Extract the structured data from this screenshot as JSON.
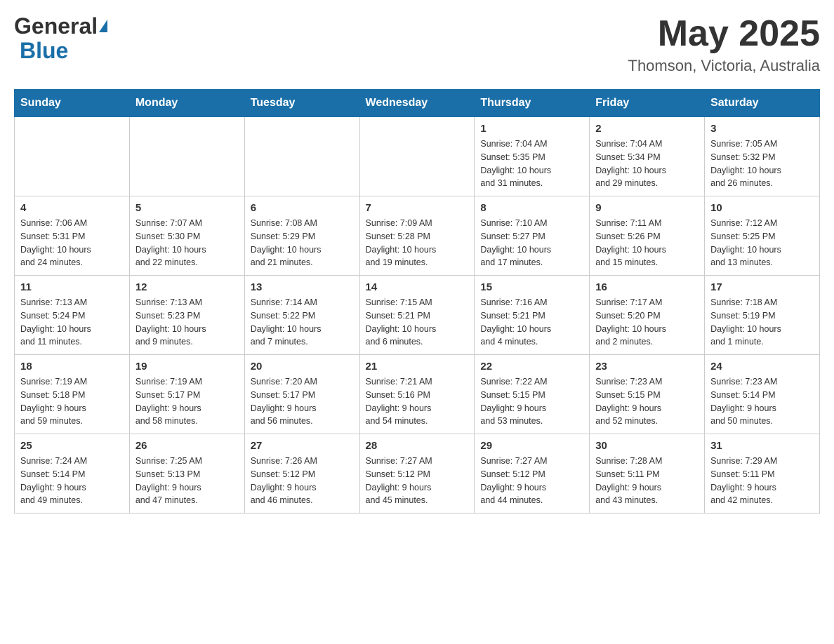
{
  "header": {
    "logo_general": "General",
    "logo_blue": "Blue",
    "title": "May 2025",
    "subtitle": "Thomson, Victoria, Australia"
  },
  "weekdays": [
    "Sunday",
    "Monday",
    "Tuesday",
    "Wednesday",
    "Thursday",
    "Friday",
    "Saturday"
  ],
  "weeks": [
    [
      {
        "day": "",
        "info": ""
      },
      {
        "day": "",
        "info": ""
      },
      {
        "day": "",
        "info": ""
      },
      {
        "day": "",
        "info": ""
      },
      {
        "day": "1",
        "info": "Sunrise: 7:04 AM\nSunset: 5:35 PM\nDaylight: 10 hours\nand 31 minutes."
      },
      {
        "day": "2",
        "info": "Sunrise: 7:04 AM\nSunset: 5:34 PM\nDaylight: 10 hours\nand 29 minutes."
      },
      {
        "day": "3",
        "info": "Sunrise: 7:05 AM\nSunset: 5:32 PM\nDaylight: 10 hours\nand 26 minutes."
      }
    ],
    [
      {
        "day": "4",
        "info": "Sunrise: 7:06 AM\nSunset: 5:31 PM\nDaylight: 10 hours\nand 24 minutes."
      },
      {
        "day": "5",
        "info": "Sunrise: 7:07 AM\nSunset: 5:30 PM\nDaylight: 10 hours\nand 22 minutes."
      },
      {
        "day": "6",
        "info": "Sunrise: 7:08 AM\nSunset: 5:29 PM\nDaylight: 10 hours\nand 21 minutes."
      },
      {
        "day": "7",
        "info": "Sunrise: 7:09 AM\nSunset: 5:28 PM\nDaylight: 10 hours\nand 19 minutes."
      },
      {
        "day": "8",
        "info": "Sunrise: 7:10 AM\nSunset: 5:27 PM\nDaylight: 10 hours\nand 17 minutes."
      },
      {
        "day": "9",
        "info": "Sunrise: 7:11 AM\nSunset: 5:26 PM\nDaylight: 10 hours\nand 15 minutes."
      },
      {
        "day": "10",
        "info": "Sunrise: 7:12 AM\nSunset: 5:25 PM\nDaylight: 10 hours\nand 13 minutes."
      }
    ],
    [
      {
        "day": "11",
        "info": "Sunrise: 7:13 AM\nSunset: 5:24 PM\nDaylight: 10 hours\nand 11 minutes."
      },
      {
        "day": "12",
        "info": "Sunrise: 7:13 AM\nSunset: 5:23 PM\nDaylight: 10 hours\nand 9 minutes."
      },
      {
        "day": "13",
        "info": "Sunrise: 7:14 AM\nSunset: 5:22 PM\nDaylight: 10 hours\nand 7 minutes."
      },
      {
        "day": "14",
        "info": "Sunrise: 7:15 AM\nSunset: 5:21 PM\nDaylight: 10 hours\nand 6 minutes."
      },
      {
        "day": "15",
        "info": "Sunrise: 7:16 AM\nSunset: 5:21 PM\nDaylight: 10 hours\nand 4 minutes."
      },
      {
        "day": "16",
        "info": "Sunrise: 7:17 AM\nSunset: 5:20 PM\nDaylight: 10 hours\nand 2 minutes."
      },
      {
        "day": "17",
        "info": "Sunrise: 7:18 AM\nSunset: 5:19 PM\nDaylight: 10 hours\nand 1 minute."
      }
    ],
    [
      {
        "day": "18",
        "info": "Sunrise: 7:19 AM\nSunset: 5:18 PM\nDaylight: 9 hours\nand 59 minutes."
      },
      {
        "day": "19",
        "info": "Sunrise: 7:19 AM\nSunset: 5:17 PM\nDaylight: 9 hours\nand 58 minutes."
      },
      {
        "day": "20",
        "info": "Sunrise: 7:20 AM\nSunset: 5:17 PM\nDaylight: 9 hours\nand 56 minutes."
      },
      {
        "day": "21",
        "info": "Sunrise: 7:21 AM\nSunset: 5:16 PM\nDaylight: 9 hours\nand 54 minutes."
      },
      {
        "day": "22",
        "info": "Sunrise: 7:22 AM\nSunset: 5:15 PM\nDaylight: 9 hours\nand 53 minutes."
      },
      {
        "day": "23",
        "info": "Sunrise: 7:23 AM\nSunset: 5:15 PM\nDaylight: 9 hours\nand 52 minutes."
      },
      {
        "day": "24",
        "info": "Sunrise: 7:23 AM\nSunset: 5:14 PM\nDaylight: 9 hours\nand 50 minutes."
      }
    ],
    [
      {
        "day": "25",
        "info": "Sunrise: 7:24 AM\nSunset: 5:14 PM\nDaylight: 9 hours\nand 49 minutes."
      },
      {
        "day": "26",
        "info": "Sunrise: 7:25 AM\nSunset: 5:13 PM\nDaylight: 9 hours\nand 47 minutes."
      },
      {
        "day": "27",
        "info": "Sunrise: 7:26 AM\nSunset: 5:12 PM\nDaylight: 9 hours\nand 46 minutes."
      },
      {
        "day": "28",
        "info": "Sunrise: 7:27 AM\nSunset: 5:12 PM\nDaylight: 9 hours\nand 45 minutes."
      },
      {
        "day": "29",
        "info": "Sunrise: 7:27 AM\nSunset: 5:12 PM\nDaylight: 9 hours\nand 44 minutes."
      },
      {
        "day": "30",
        "info": "Sunrise: 7:28 AM\nSunset: 5:11 PM\nDaylight: 9 hours\nand 43 minutes."
      },
      {
        "day": "31",
        "info": "Sunrise: 7:29 AM\nSunset: 5:11 PM\nDaylight: 9 hours\nand 42 minutes."
      }
    ]
  ]
}
